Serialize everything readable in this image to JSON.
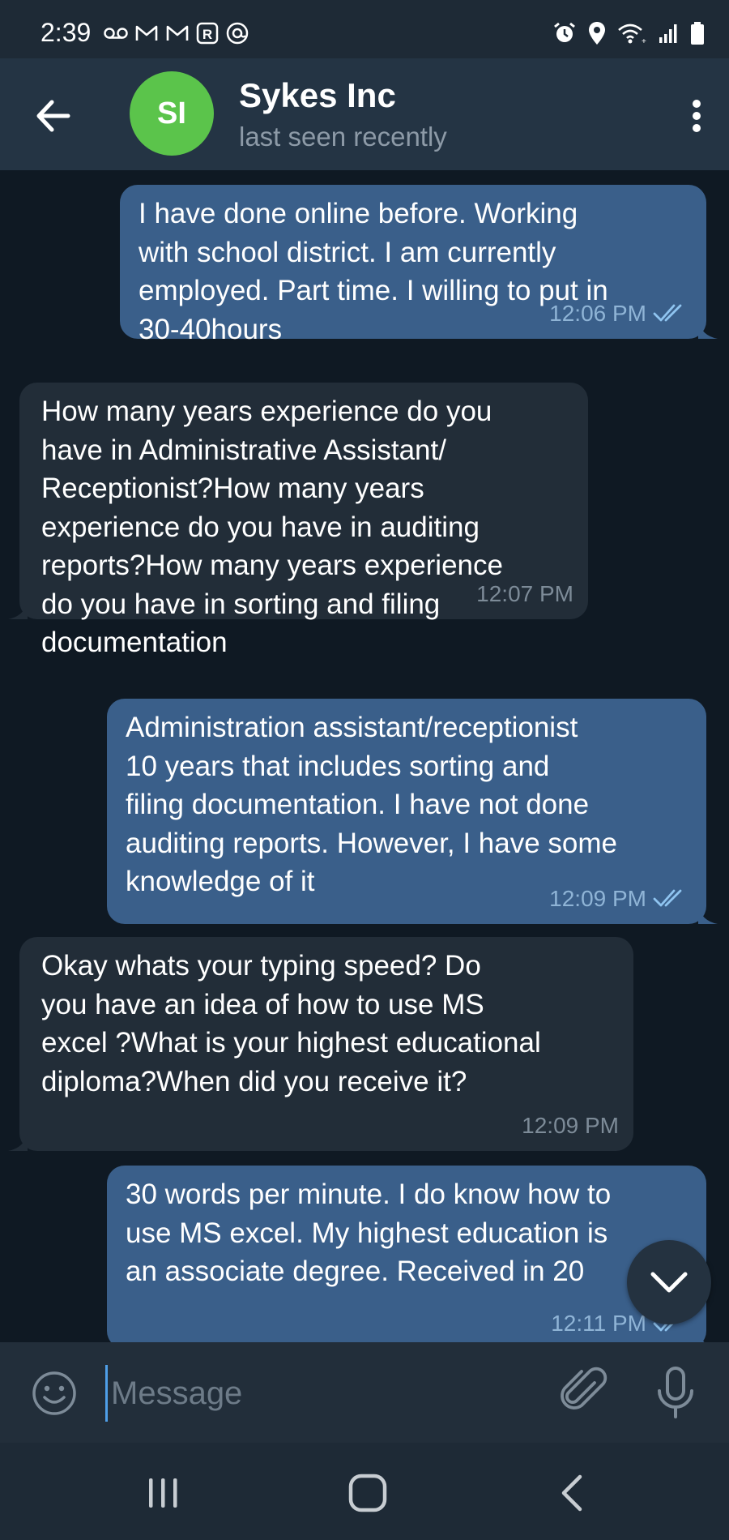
{
  "status_bar": {
    "time": "2:39",
    "left_icons": [
      "voicemail-icon",
      "gmail-icon",
      "gmail-icon",
      "r-app-icon",
      "threads-icon"
    ],
    "right_icons": [
      "alarm-icon",
      "location-icon",
      "wifi-icon",
      "signal-icon",
      "battery-icon"
    ]
  },
  "header": {
    "avatar_initials": "SI",
    "avatar_color": "#5bc44b",
    "chat_name": "Sykes Inc",
    "chat_status": "last seen recently"
  },
  "messages": [
    {
      "direction": "outgoing",
      "text": "I have done online before. Working\nwith school district. I am currently\nemployed. Part time. I willing to put in\n30-40hours",
      "time": "12:06 PM",
      "status_icon": "double-check-icon"
    },
    {
      "direction": "incoming",
      "text": "How many years experience do you\nhave in Administrative Assistant/\nReceptionist?How many years\nexperience do you have in auditing\nreports?How many years experience\ndo you have in sorting and filing\ndocumentation",
      "time": "12:07 PM"
    },
    {
      "direction": "outgoing",
      "text": "Administration assistant/receptionist\n10 years that includes sorting and\nfiling documentation. I have not done\nauditing reports. However, I have some\nknowledge of it",
      "time": "12:09 PM",
      "status_icon": "double-check-icon"
    },
    {
      "direction": "incoming",
      "text": "Okay whats your typing speed? Do\nyou have an idea of how to use MS\nexcel ?What is your highest educational\ndiploma?When did you receive it?",
      "time": "12:09 PM"
    },
    {
      "direction": "outgoing",
      "text": "30 words per minute. I do know how to\nuse MS excel. My highest education is\nan associate degree. Received in 20",
      "time": "12:11 PM",
      "status_icon": "double-check-icon"
    }
  ],
  "input": {
    "placeholder": "Message"
  },
  "colors": {
    "outgoing_bubble": "#3a5f8a",
    "incoming_bubble": "#222d38",
    "chat_background": "#0f1923",
    "header_background": "#243444",
    "accent": "#4f9fe8"
  }
}
